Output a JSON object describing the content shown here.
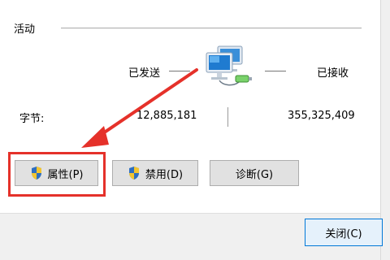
{
  "group": {
    "label": "活动"
  },
  "columns": {
    "sent_label": "已发送",
    "received_label": "已接收"
  },
  "bytes": {
    "label": "字节:",
    "sent": "12,885,181",
    "received": "355,325,409"
  },
  "buttons": {
    "properties": "属性(P)",
    "disable": "禁用(D)",
    "diagnose": "诊断(G)",
    "close": "关闭(C)"
  },
  "icons": {
    "network": "network-computers-icon",
    "shield": "uac-shield-icon"
  },
  "colors": {
    "annotation_red": "#e5312a",
    "button_bg": "#e1e1e1",
    "focus_border": "#0078d7",
    "footer_bg": "#f0f0f0"
  }
}
